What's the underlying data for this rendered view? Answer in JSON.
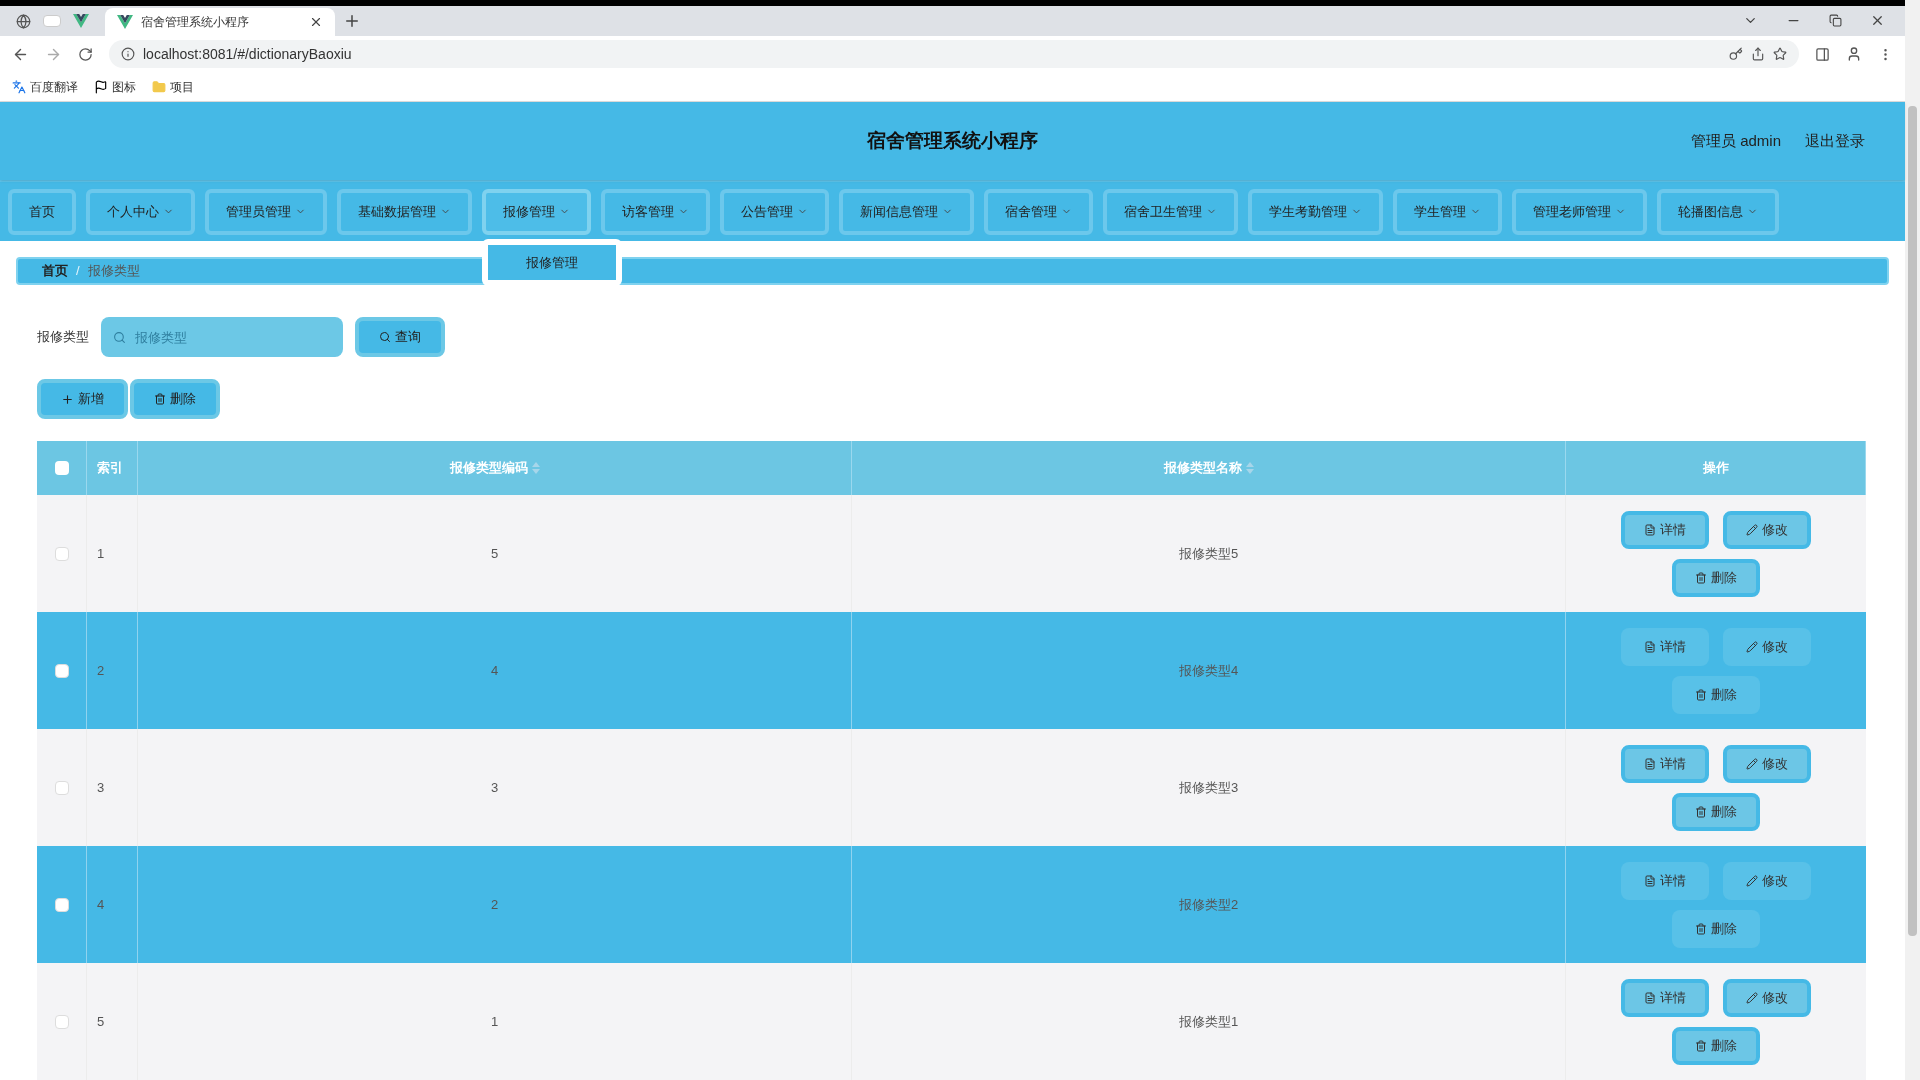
{
  "browser": {
    "tab_title": "宿舍管理系统小程序",
    "url": "localhost:8081/#/dictionaryBaoxiu",
    "bookmarks": [
      {
        "kind": "translate",
        "label": "百度翻译"
      },
      {
        "kind": "flag",
        "label": "图标"
      },
      {
        "kind": "folder",
        "label": "项目"
      }
    ]
  },
  "header": {
    "title": "宿舍管理系统小程序",
    "user": "管理员 admin",
    "logout": "退出登录"
  },
  "nav": [
    {
      "label": "首页",
      "dropdown": false,
      "expanded": false
    },
    {
      "label": "个人中心",
      "dropdown": true,
      "expanded": false
    },
    {
      "label": "管理员管理",
      "dropdown": true,
      "expanded": false
    },
    {
      "label": "基础数据管理",
      "dropdown": true,
      "expanded": false
    },
    {
      "label": "报修管理",
      "dropdown": true,
      "expanded": true,
      "menu": [
        "报修管理"
      ]
    },
    {
      "label": "访客管理",
      "dropdown": true,
      "expanded": false
    },
    {
      "label": "公告管理",
      "dropdown": true,
      "expanded": false
    },
    {
      "label": "新闻信息管理",
      "dropdown": true,
      "expanded": false
    },
    {
      "label": "宿舍管理",
      "dropdown": true,
      "expanded": false
    },
    {
      "label": "宿舍卫生管理",
      "dropdown": true,
      "expanded": false
    },
    {
      "label": "学生考勤管理",
      "dropdown": true,
      "expanded": false
    },
    {
      "label": "学生管理",
      "dropdown": true,
      "expanded": false
    },
    {
      "label": "管理老师管理",
      "dropdown": true,
      "expanded": false
    },
    {
      "label": "轮播图信息",
      "dropdown": true,
      "expanded": false
    }
  ],
  "breadcrumb": [
    "首页",
    "报修类型"
  ],
  "breadcrumb_separator": "/",
  "search": {
    "label": "报修类型",
    "placeholder": "报修类型",
    "button": "查询"
  },
  "actions": [
    {
      "kind": "add",
      "label": "新增"
    },
    {
      "kind": "delete",
      "label": "删除"
    }
  ],
  "table": {
    "header_checked": false,
    "columns": [
      {
        "label": "索引",
        "sortable": false
      },
      {
        "label": "报修类型编码",
        "sortable": true
      },
      {
        "label": "报修类型名称",
        "sortable": true
      },
      {
        "label": "操作",
        "sortable": false
      }
    ],
    "rows": [
      {
        "checked": false,
        "highlighted": false,
        "index": "1",
        "code": "5",
        "name": "报修类型5",
        "actions": [
          {
            "kind": "detail",
            "label": "详情"
          },
          {
            "kind": "edit",
            "label": "修改"
          },
          {
            "kind": "delete",
            "label": "删除"
          }
        ]
      },
      {
        "checked": false,
        "highlighted": true,
        "index": "2",
        "code": "4",
        "name": "报修类型4",
        "actions": [
          {
            "kind": "detail",
            "label": "详情"
          },
          {
            "kind": "edit",
            "label": "修改"
          },
          {
            "kind": "delete",
            "label": "删除"
          }
        ]
      },
      {
        "checked": false,
        "highlighted": false,
        "index": "3",
        "code": "3",
        "name": "报修类型3",
        "actions": [
          {
            "kind": "detail",
            "label": "详情"
          },
          {
            "kind": "edit",
            "label": "修改"
          },
          {
            "kind": "delete",
            "label": "删除"
          }
        ]
      },
      {
        "checked": false,
        "highlighted": true,
        "index": "4",
        "code": "2",
        "name": "报修类型2",
        "actions": [
          {
            "kind": "detail",
            "label": "详情"
          },
          {
            "kind": "edit",
            "label": "修改"
          },
          {
            "kind": "delete",
            "label": "删除"
          }
        ]
      },
      {
        "checked": false,
        "highlighted": false,
        "index": "5",
        "code": "1",
        "name": "报修类型1",
        "actions": [
          {
            "kind": "detail",
            "label": "详情"
          },
          {
            "kind": "edit",
            "label": "修改"
          },
          {
            "kind": "delete",
            "label": "删除"
          }
        ]
      }
    ]
  }
}
